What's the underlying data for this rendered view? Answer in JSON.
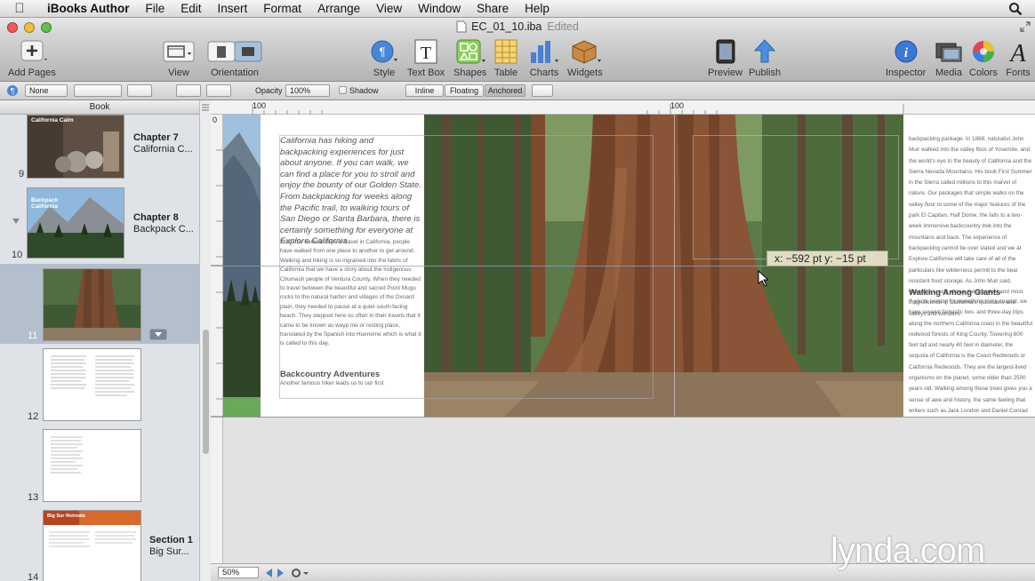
{
  "menubar": {
    "app_name": "iBooks Author",
    "items": [
      "File",
      "Edit",
      "Insert",
      "Format",
      "Arrange",
      "View",
      "Window",
      "Share",
      "Help"
    ]
  },
  "window": {
    "title": "EC_01_10.iba",
    "status": "Edited"
  },
  "toolbar": {
    "add_pages": "Add Pages",
    "view": "View",
    "orientation": "Orientation",
    "style": "Style",
    "text_box": "Text Box",
    "shapes": "Shapes",
    "table": "Table",
    "charts": "Charts",
    "widgets": "Widgets",
    "preview": "Preview",
    "publish": "Publish",
    "inspector": "Inspector",
    "media": "Media",
    "colors": "Colors",
    "fonts": "Fonts"
  },
  "formatbar": {
    "fill_value": "None",
    "opacity_label": "Opacity",
    "opacity_value": "100%",
    "shadow_label": "Shadow",
    "wrap_inline": "Inline",
    "wrap_floating": "Floating",
    "wrap_anchored": "Anchored"
  },
  "sidebar": {
    "header": "Book",
    "pages": [
      {
        "number": "9",
        "chapter": "Chapter 7",
        "subtitle": "California C...",
        "thumb_title": "California Calm"
      },
      {
        "number": "10",
        "chapter": "Chapter 8",
        "subtitle": "Backpack C...",
        "thumb_title": "Backpack California"
      },
      {
        "number": "11"
      },
      {
        "number": "12"
      },
      {
        "number": "13"
      },
      {
        "number": "14",
        "chapter": "Section 1",
        "subtitle": "Big Sur...",
        "thumb_title": "Big Sur Retreats"
      }
    ]
  },
  "rulers": {
    "h_left": "100",
    "h_mid": "100",
    "v_zero": "0"
  },
  "page": {
    "intro": "California has hiking and backpacking experiences for just about anyone. If you can walk, we can find a place for you to stroll and enjoy the bounty of our Golden State. From backpacking for weeks along the Pacific trail, to walking tours of San Diego or Santa Barbara, there is certainly something for everyone at Explore California.",
    "body1": "From the earliest days of travel in California, people have walked from one place to another to get around. Walking and hiking is so ingrained into the fabric of California that we have a story about the Indigenous Chumash people of Ventura County. When they needed to travel between the beautiful and sacred Point Mugu rocks to the natural harbor and villages of the Oxnard plain, they needed to pause at a quiet south-facing beach. They stepped here so often in their travels that it came to be known as wayp me or resting place, translated by the Spanish into Hueneme which is what it is called to this day.",
    "heading": "Backcountry Adventures",
    "body2": "Another famous hiker leads us to our first",
    "right_body": "backpacking package. In 1868, naturalist John Muir walked into the valley floor of Yosemite, and the world's eye to the beauty of California and the Sierra Nevada Mountains. His book First Summer in the Sierra called millions to this marvel of nature. Our packages that simple walks on the valley floor to some of the major features of the park El Capitan, Half Dome, the falls to a two-week immersive backcountry trek into the mountains and back. The experience of backpacking cannot be over stated and we at Explore California will take care of all of the particulars like wilderness permit to the bear resistant food storage. As John Muir said, Yosemite surely shows the grandest and most magnificence of California's mountains and valleys and wonders.",
    "right_heading": "Walking Among Giants",
    "right_body2": "If you're looking for something more coastal, we have several fantastic two- and three-day trips along the northern California coast in the beautiful redwood forests of King County. Towering 600 feet tall and nearly 40 feet in diameter, the sequoia of California is the Coast Redwoods or California Redwoods. They are the largest-lived organisms on the planet, some older than 2500 years old. Walking among these trees gives you a sense of awe and history, the same feeling that writers such as Jack London and Daniel Conrad"
  },
  "tooltip": {
    "text": "x: −592 pt   y: −15 pt"
  },
  "bottombar": {
    "zoom": "50%"
  },
  "watermark": "lynda.com"
}
